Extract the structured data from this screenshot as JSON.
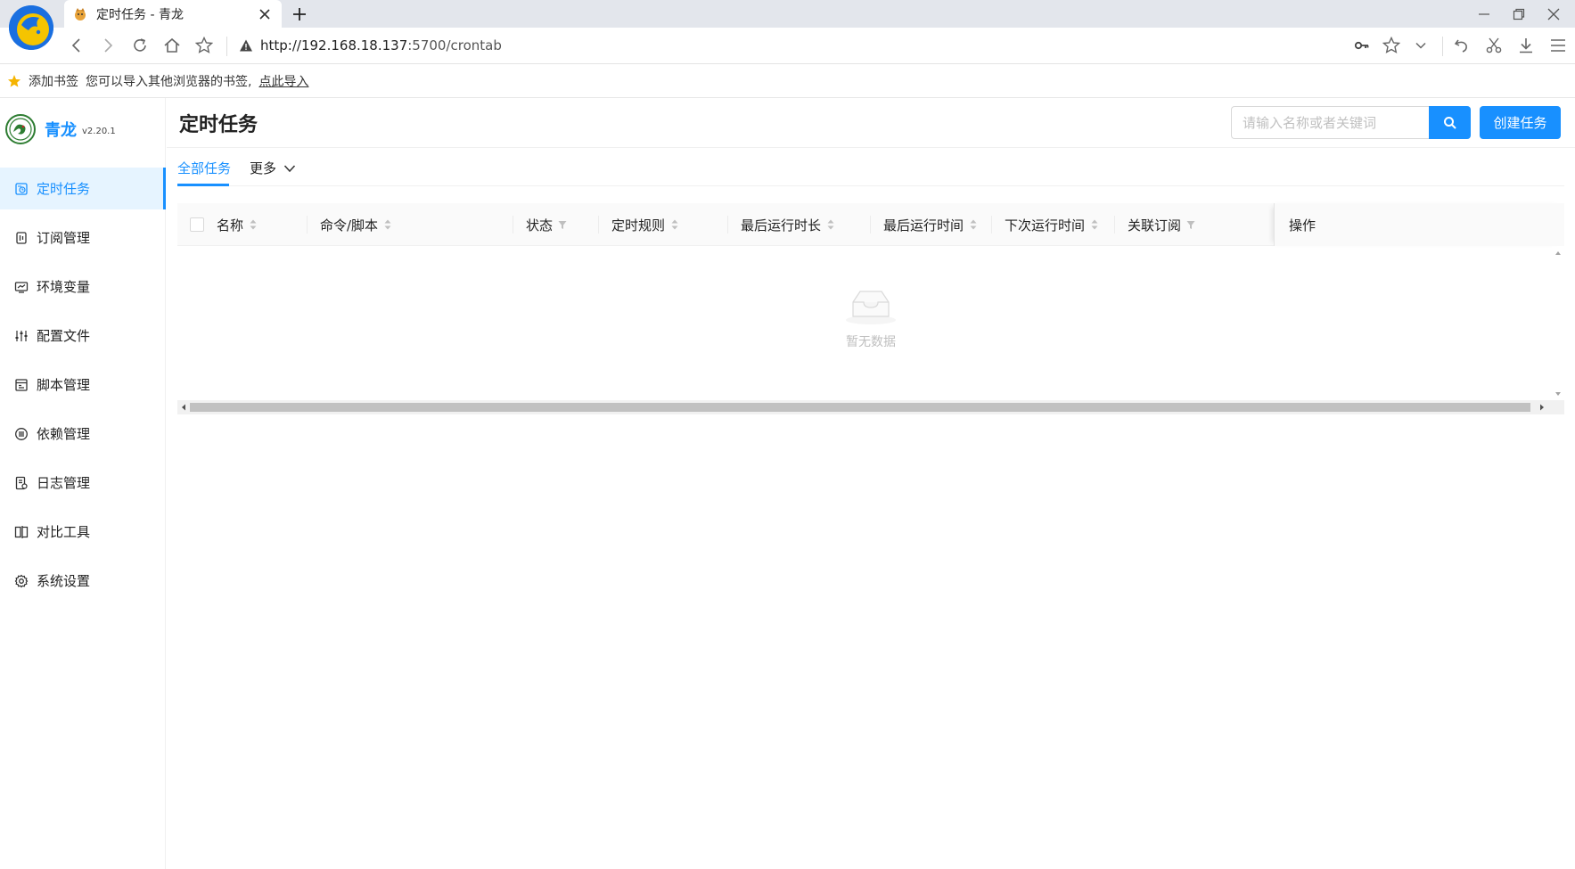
{
  "browser": {
    "tab_title": "定时任务 - 青龙",
    "url_host": "http://192.168.18.137",
    "url_path": ":5700/crontab",
    "bookmark": {
      "add_label": "添加书签",
      "hint": "您可以导入其他浏览器的书签,",
      "import_link": "点此导入"
    }
  },
  "app": {
    "brand_name": "青龙",
    "version": "v2.20.1",
    "menu": [
      {
        "label": "定时任务",
        "icon": "clock-icon",
        "active": true
      },
      {
        "label": "订阅管理",
        "icon": "subscribe-icon"
      },
      {
        "label": "环境变量",
        "icon": "monitor-icon"
      },
      {
        "label": "配置文件",
        "icon": "sliders-icon"
      },
      {
        "label": "脚本管理",
        "icon": "script-icon"
      },
      {
        "label": "依赖管理",
        "icon": "dependency-icon"
      },
      {
        "label": "日志管理",
        "icon": "log-icon"
      },
      {
        "label": "对比工具",
        "icon": "diff-icon"
      },
      {
        "label": "系统设置",
        "icon": "gear-icon"
      }
    ]
  },
  "page": {
    "title": "定时任务",
    "search_placeholder": "请输入名称或者关键词",
    "create_label": "创建任务",
    "tabs": {
      "all": "全部任务",
      "more": "更多"
    },
    "columns": {
      "name": "名称",
      "command": "命令/脚本",
      "status": "状态",
      "schedule": "定时规则",
      "last_duration": "最后运行时长",
      "last_run": "最后运行时间",
      "next_run": "下次运行时间",
      "subscription": "关联订阅",
      "actions": "操作"
    },
    "empty_text": "暂无数据"
  },
  "colors": {
    "primary": "#1890ff"
  }
}
